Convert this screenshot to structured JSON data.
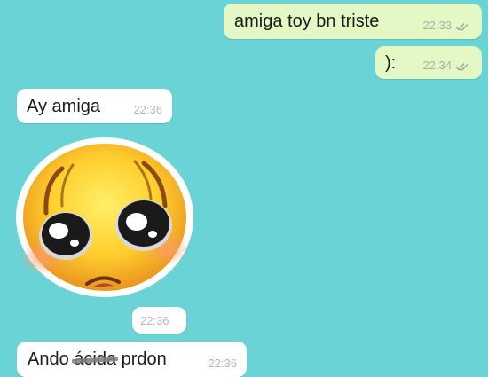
{
  "messages": [
    {
      "direction": "out",
      "text": "amiga toy bn triste",
      "time": "22:33",
      "status": "read-double-check-icon"
    },
    {
      "direction": "out",
      "text": "):",
      "time": "22:34",
      "status": "read-double-check-icon"
    },
    {
      "direction": "in",
      "text": "Ay amiga",
      "time": "22:36"
    },
    {
      "direction": "in",
      "type": "sticker",
      "sticker": "pleading-face-sticker",
      "time": "22:36"
    },
    {
      "direction": "in",
      "text_before": "Ando ",
      "text_struck": "ácida",
      "text_after": " prdon",
      "time": "22:36"
    }
  ],
  "colors": {
    "background": "#6ad3d6",
    "outgoing_bubble": "#e4f8c6",
    "incoming_bubble": "#ffffff"
  }
}
